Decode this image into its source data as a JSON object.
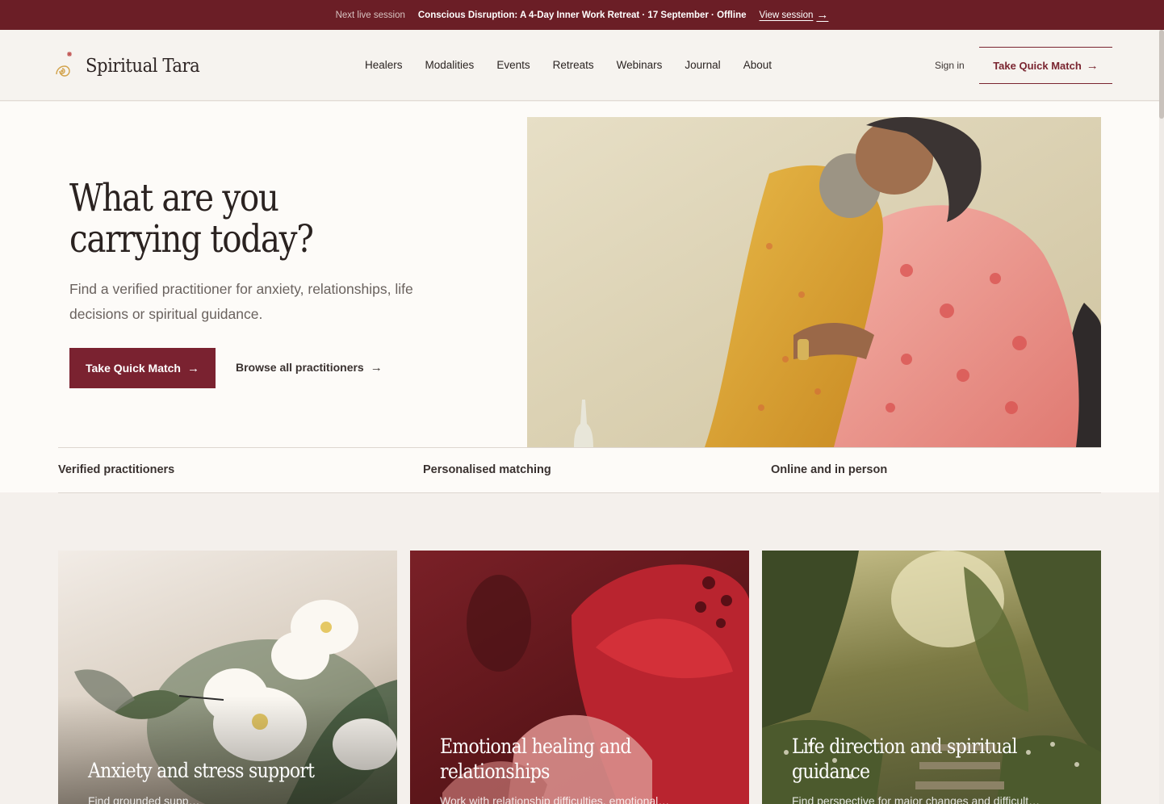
{
  "announce": {
    "label": "Next live session",
    "title": "Conscious Disruption: A 4-Day Inner Work Retreat · 17 September · Offline",
    "link": "View session"
  },
  "header": {
    "brand": "Spiritual Tara",
    "nav": [
      "Healers",
      "Modalities",
      "Events",
      "Retreats",
      "Webinars",
      "Journal",
      "About"
    ],
    "signin": "Sign in",
    "cta": "Take Quick Match"
  },
  "hero": {
    "headline_1": "What are you",
    "headline_2": "carrying today?",
    "subtitle": "Find a verified practitioner for anxiety, relationships, life decisions or spiritual guidance.",
    "cta": "Take Quick Match",
    "browse": "Browse all practitioners"
  },
  "trust": [
    "Verified practitioners",
    "Personalised matching",
    "Online and in person"
  ],
  "cards": [
    {
      "title_1": "Anxiety and stress support",
      "title_2": "",
      "desc": "Find grounded supp…"
    },
    {
      "title_1": "Emotional healing and",
      "title_2": "relationships",
      "desc": "Work with relationship difficulties, emotional…"
    },
    {
      "title_1": "Life direction and spiritual",
      "title_2": "guidance",
      "desc": "Find perspective for major changes and difficult…"
    }
  ],
  "colors": {
    "brand": "#6b1e26",
    "cta": "#7a2230",
    "background": "#f4f0ec"
  },
  "icons": {
    "arrow": "→"
  }
}
